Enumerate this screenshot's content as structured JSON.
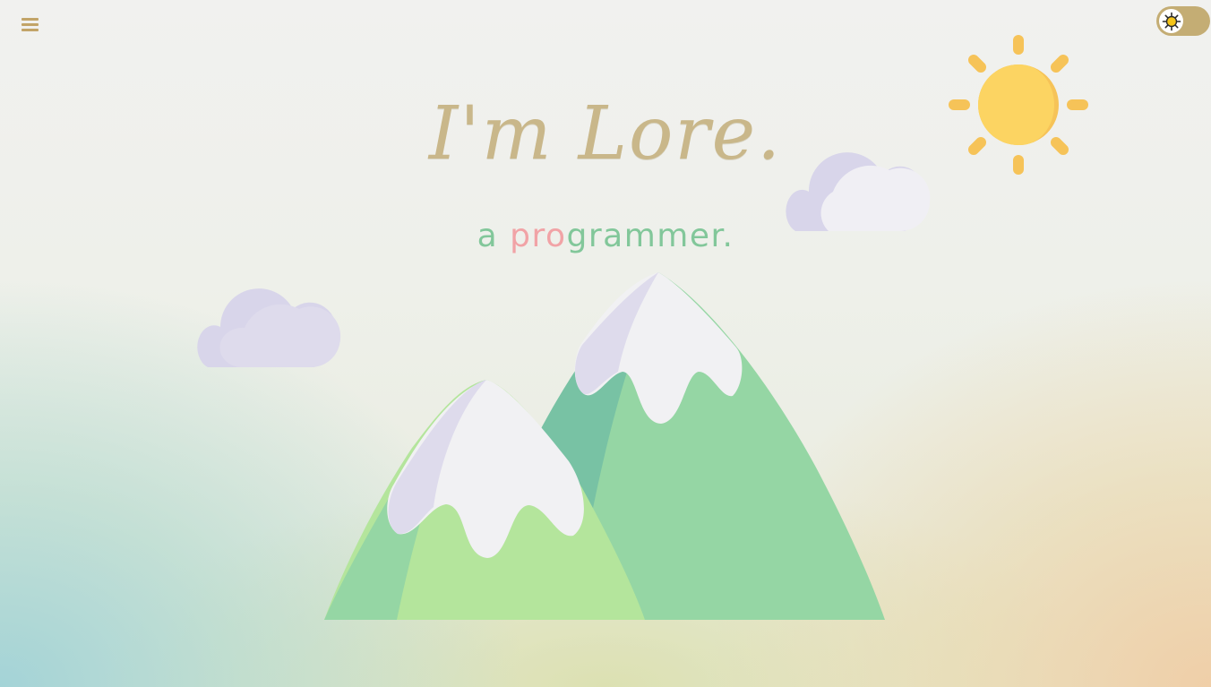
{
  "nav": {
    "menu_icon": "hamburger-menu-icon"
  },
  "theme_toggle": {
    "icon": "sun-icon",
    "state": "light",
    "track_color": "#c4ad74"
  },
  "hero": {
    "title": "I'm Lore.",
    "subtitle_prefix": "a ",
    "subtitle_accent": "pro",
    "subtitle_suffix": "grammer."
  },
  "colors": {
    "title": "#c9b78a",
    "subtitle": "#82c79a",
    "subtitle_accent": "#f1a3a6",
    "sun": "#fcd462",
    "sun_shade": "#f6c358",
    "mountain_green": "#95d6a4",
    "mountain_dark": "#78c2a4",
    "mountain_light": "#b4e59c",
    "snow": "#f1f1f3",
    "snow_shade": "#dedbec",
    "cloud": "#f0eff4",
    "cloud_shade": "#d8d5ea"
  }
}
